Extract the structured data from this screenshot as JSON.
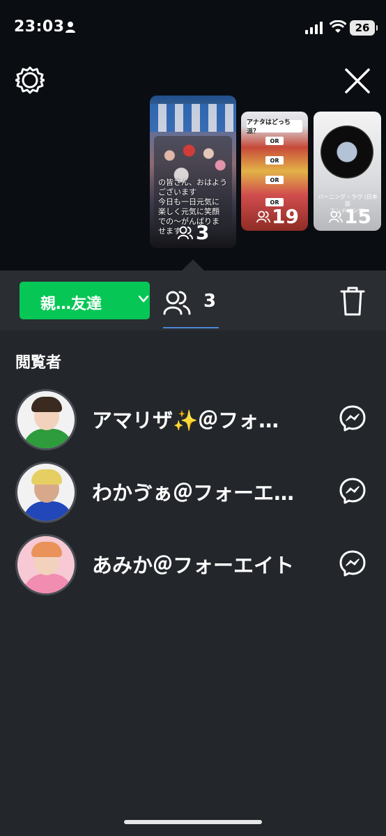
{
  "status_bar": {
    "time": "23:03",
    "battery": "26"
  },
  "stories": [
    {
      "caption": "の皆さん、おはよう\nございます\n今日も一日元気に\n楽しく元気に笑顔\nでの〜がんばりま\nせます",
      "viewer_count": "3"
    },
    {
      "question": "アナタはどっち派？",
      "or_label": "OR",
      "viewer_count": "19"
    },
    {
      "song": "バーニング・ラヴ (日本版\nエンドソング)",
      "viewer_count": "15"
    }
  ],
  "header": {
    "privacy_label": "親…友達",
    "viewer_count": "3"
  },
  "viewers_section": {
    "title": "閲覧者",
    "viewers": [
      {
        "name": "アマリザ✨＠フォ…"
      },
      {
        "name": "わかゔぁ＠フォーエ…"
      },
      {
        "name": "あみか＠フォーエイト"
      }
    ]
  },
  "colors": {
    "accent_green": "#06c755",
    "tab_underline": "#4a88d6",
    "panel_bg": "#23262b"
  }
}
